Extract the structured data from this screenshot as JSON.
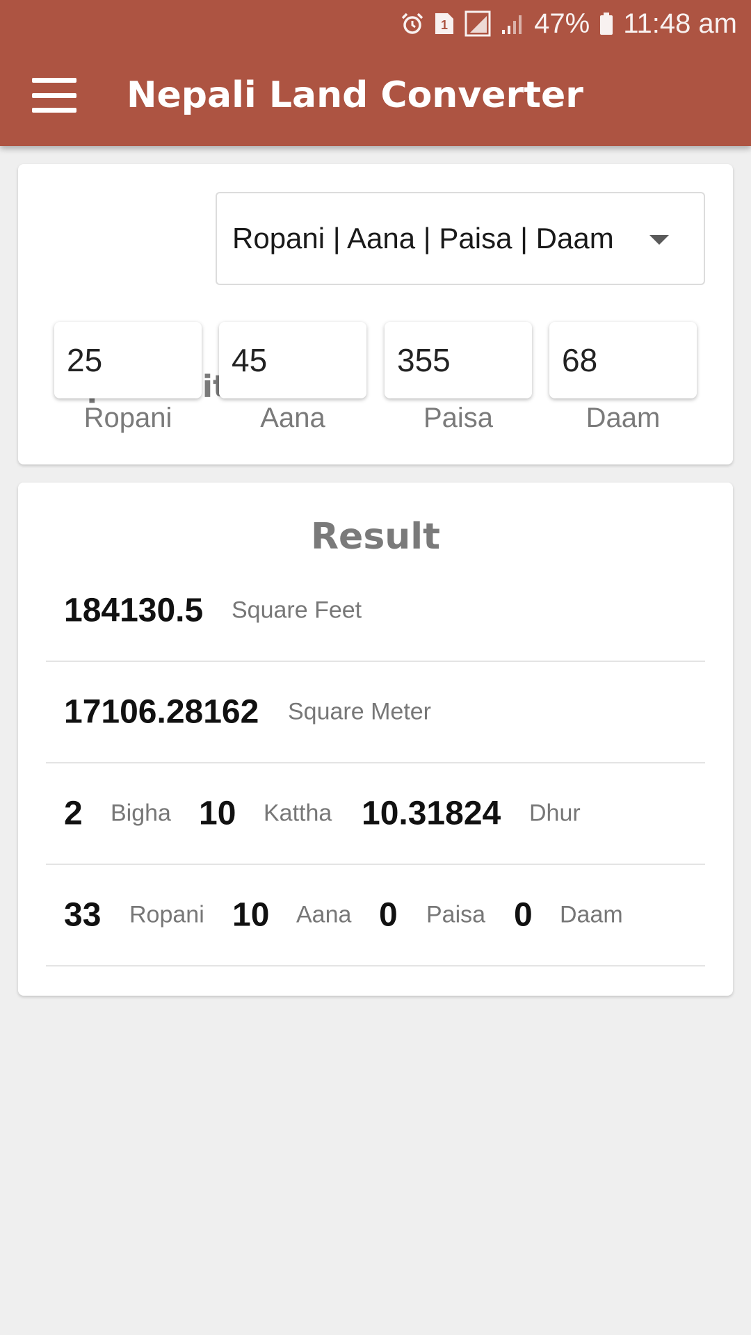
{
  "status_bar": {
    "battery": "47%",
    "time": "11:48 am",
    "icons": [
      "alarm-icon",
      "sim-1-icon",
      "signal-icon",
      "signal-icon",
      "battery-icon"
    ]
  },
  "app_bar": {
    "title": "Nepali Land Converter",
    "menu_icon": "menu-icon",
    "color": "#ad5442"
  },
  "input_card": {
    "input_unit_label": "Input Unit",
    "selected_unit": "Ropani | Aana | Paisa | Daam",
    "fields": [
      {
        "value": "25",
        "label": "Ropani"
      },
      {
        "value": "45",
        "label": "Aana"
      },
      {
        "value": "355",
        "label": "Paisa"
      },
      {
        "value": "68",
        "label": "Daam"
      }
    ]
  },
  "result_card": {
    "title": "Result",
    "square_feet": {
      "value": "184130.5",
      "unit": "Square Feet"
    },
    "square_meter": {
      "value": "17106.28162",
      "unit": "Square Meter"
    },
    "bigha_row": [
      {
        "value": "2",
        "unit": "Bigha"
      },
      {
        "value": "10",
        "unit": "Kattha"
      },
      {
        "value": "10.31824",
        "unit": "Dhur"
      }
    ],
    "ropani_row": [
      {
        "value": "33",
        "unit": "Ropani"
      },
      {
        "value": "10",
        "unit": "Aana"
      },
      {
        "value": "0",
        "unit": "Paisa"
      },
      {
        "value": "0",
        "unit": "Daam"
      }
    ]
  }
}
